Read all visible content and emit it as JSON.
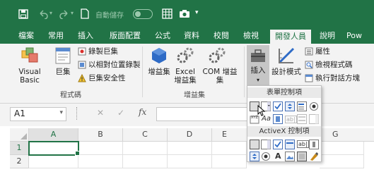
{
  "titlebar": {
    "autosave_label": "自動儲存",
    "autosave_state": "關閉"
  },
  "tabs": [
    {
      "label": "檔案"
    },
    {
      "label": "常用"
    },
    {
      "label": "插入"
    },
    {
      "label": "版面配置"
    },
    {
      "label": "公式"
    },
    {
      "label": "資料"
    },
    {
      "label": "校閱"
    },
    {
      "label": "檢視"
    },
    {
      "label": "開發人員"
    },
    {
      "label": "說明"
    },
    {
      "label": "Pow"
    }
  ],
  "active_tab": "開發人員",
  "ribbon": {
    "code_group": {
      "label": "程式碼",
      "visual_basic": "Visual Basic",
      "macros": "巨集",
      "record_macro": "錄製巨集",
      "relative_refs": "以相對位置錄製",
      "macro_security": "巨集安全性"
    },
    "addins_group": {
      "label": "增益集",
      "addins": "增益集",
      "excel_addins": "Excel 增益集",
      "com_addins": "COM 增益集"
    },
    "controls_group": {
      "insert": "插入",
      "design_mode": "設計模式",
      "properties": "屬性",
      "view_code": "檢視程式碼",
      "run_dialog": "執行對話方塊"
    }
  },
  "formula_bar": {
    "name_box": "A1",
    "fx_symbol": "fx",
    "cancel_symbol": "✕",
    "enter_symbol": "✓",
    "formula": ""
  },
  "grid": {
    "columns": [
      "A",
      "B",
      "C",
      "D",
      "E",
      "F",
      "G"
    ],
    "rows": [
      "1",
      "2"
    ]
  },
  "insert_dropdown": {
    "form_controls_header": "表單控制項",
    "activex_controls_header": "ActiveX 控制項"
  },
  "colors": {
    "brand": "#217346",
    "ribbon_bg": "#f3f3f3"
  }
}
